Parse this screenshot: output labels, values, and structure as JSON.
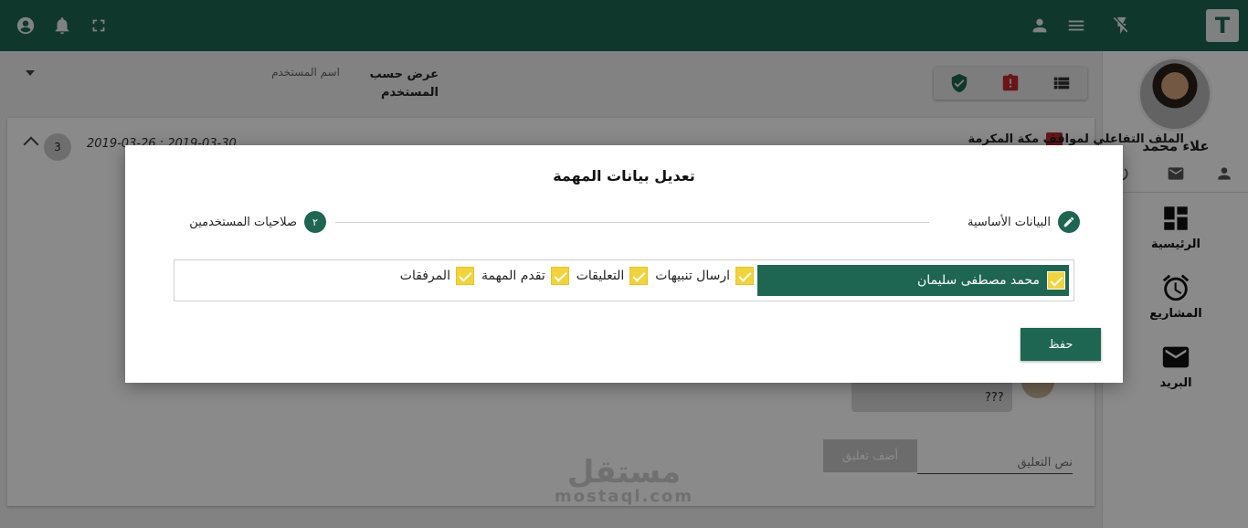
{
  "brand": {
    "logo_letter": "T"
  },
  "user": {
    "name": "علاء محمد"
  },
  "sidebar": {
    "items": [
      {
        "label": "الرئيسية",
        "icon": "dashboard-icon"
      },
      {
        "label": "المشاريع",
        "icon": "alarm-clock-icon"
      },
      {
        "label": "البريد",
        "icon": "mail-icon"
      }
    ]
  },
  "filter": {
    "view_by_label": "عرض حسب المستخدم",
    "user_placeholder": "اسم المستخدم"
  },
  "project": {
    "title": "الملف التفاعلي لمواقف مكة المكرمة",
    "date_range": "2019-03-26 : 2019-03-30",
    "count": "3"
  },
  "comments": {
    "sample_text": "???",
    "add_button": "أضف تعليق",
    "input_placeholder": "نص التعليق"
  },
  "watermark": {
    "arabic": "مستقل",
    "latin": "mostaql.com"
  },
  "modal": {
    "title": "تعديل بيانات المهمة",
    "steps": [
      {
        "label": "البيانات الأساسية",
        "icon": "pencil-icon"
      },
      {
        "label": "صلاحيات المستخدمين",
        "number": "٢"
      }
    ],
    "assignee": {
      "name": "محمد مصطفى سليمان",
      "checked": true
    },
    "permissions": [
      {
        "label": "ارسال تنبيهات",
        "checked": true
      },
      {
        "label": "التعليقات",
        "checked": true
      },
      {
        "label": "تقدم المهمة",
        "checked": true
      },
      {
        "label": "المرفقات",
        "checked": true
      }
    ],
    "save_label": "حفظ"
  },
  "colors": {
    "primary": "#1e6651",
    "checkbox": "#f2d33a",
    "danger": "#c0272d"
  }
}
